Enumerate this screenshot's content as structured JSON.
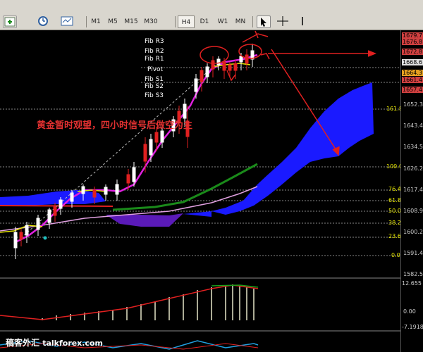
{
  "toolbar": {
    "timeframes": [
      "M1",
      "M5",
      "M15",
      "M30",
      "H4",
      "D1",
      "W1",
      "MN"
    ],
    "active_timeframe": "H4",
    "icons": [
      "new-chart-icon",
      "history-icon",
      "template-icon",
      "cursor-icon",
      "crosshair-icon",
      "line-tool-icon"
    ]
  },
  "chart": {
    "symbol_hint": "",
    "annotation": "黄金暂时观望，四小时信号后做空为主",
    "pivot_labels": {
      "r3": "Fib R3",
      "r2": "Fib R2",
      "r1": "Fib R1",
      "pivot": "Pivot",
      "s1": "Fib S1",
      "s2": "Fib S2",
      "s3": "Fib S3"
    },
    "fib_retracement_labels": [
      "161.8",
      "100.0",
      "76.4",
      "61.8",
      "50.0",
      "38.2",
      "23.6",
      "0.0"
    ],
    "price_axis": [
      "1679.7",
      "1676.8",
      "1672.8",
      "1668.6",
      "1664.3",
      "1661.4",
      "1657.4",
      "1652.3",
      "1643.4",
      "1634.5",
      "1626.2",
      "1617.4",
      "1608.9",
      "1600.2",
      "1591.4",
      "1582.5"
    ],
    "price_tags": [
      {
        "value": "1679.7",
        "color": "#d04040"
      },
      {
        "value": "1676.8",
        "color": "#d04040"
      },
      {
        "value": "1672.8",
        "color": "#d04040"
      },
      {
        "value": "1668.6",
        "color": "#e0e0e0"
      },
      {
        "value": "1664.3",
        "color": "#e6a020"
      },
      {
        "value": "1661.4",
        "color": "#d04040"
      },
      {
        "value": "1657.4",
        "color": "#d04040"
      }
    ],
    "macd_axis": [
      "12.655",
      "0.00",
      "-7.1918"
    ]
  },
  "colors": {
    "cloud": "#1a1aff",
    "cloud_bottom": "#5a1ab8",
    "ma_magenta": "#e020e0",
    "ma_green": "#1a8a1a",
    "ma_pink": "#e0a0e0",
    "red_line": "#e02020",
    "candle_up": "#ffffff",
    "candle_down": "#e02020",
    "fib_line": "#e6e600"
  },
  "watermark": {
    "cn": "稿客外汇",
    "site": "talkforex.com"
  }
}
